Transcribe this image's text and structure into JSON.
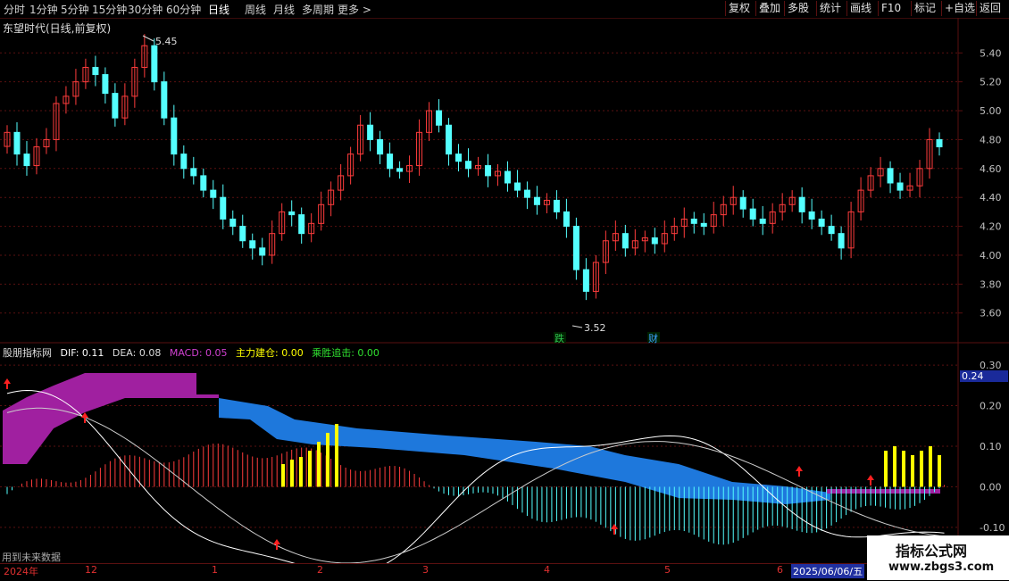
{
  "toolbar": {
    "periods": [
      "分时",
      "1分钟",
      "5分钟",
      "15分钟",
      "30分钟",
      "60分钟",
      "日线",
      "周线",
      "月线",
      "多周期",
      "更多"
    ],
    "active_period": "日线",
    "right_buttons": [
      "复权",
      "叠加",
      "多股",
      "统计",
      "画线",
      "F10",
      "标记",
      "+自选",
      "返回"
    ]
  },
  "main": {
    "title": "东望时代(日线,前复权)",
    "high_marker": "5.45",
    "low_marker": "3.52",
    "badges": [
      {
        "text": "跌",
        "color": "#2ec850"
      },
      {
        "text": "财",
        "color": "#3aa0ff"
      }
    ],
    "y_ticks": [
      "5.40",
      "5.20",
      "5.00",
      "4.80",
      "4.60",
      "4.40",
      "4.20",
      "4.00",
      "3.80",
      "3.60"
    ]
  },
  "indicator": {
    "name": "股朋指标网",
    "dif": "DIF: 0.11",
    "dea": "DEA: 0.08",
    "macd": "MACD: 0.05",
    "zhuli": "主力建仓: 0.00",
    "chengsheng": "乘胜追击: 0.00",
    "y_ticks": [
      "0.30",
      "0.20",
      "0.10",
      "0.00",
      "-0.10"
    ],
    "current_value": "0.24",
    "footer_note": "用到未来数据"
  },
  "datebar": {
    "labels": [
      "2024年",
      "12",
      "1",
      "2",
      "3",
      "4",
      "5",
      "6"
    ],
    "current_date": "2025/06/06/五"
  },
  "watermark": {
    "title": "指标公式网",
    "url": "www.zbgs3.com"
  },
  "colors": {
    "up": "#ff3c3c",
    "down": "#54ffff",
    "purple": "#a020a0",
    "blue": "#1e78dc",
    "yellow": "#ffff00",
    "grid": "#5a1010"
  },
  "chart_data": {
    "type": "candlestick",
    "y_range": [
      3.45,
      5.55
    ],
    "closes": [
      4.85,
      4.7,
      4.62,
      4.75,
      4.8,
      5.05,
      5.1,
      5.2,
      5.3,
      5.25,
      5.12,
      4.95,
      5.1,
      5.3,
      5.45,
      5.2,
      4.95,
      4.7,
      4.6,
      4.55,
      4.45,
      4.4,
      4.25,
      4.2,
      4.1,
      4.05,
      4.0,
      4.15,
      4.3,
      4.28,
      4.15,
      4.22,
      4.35,
      4.45,
      4.55,
      4.7,
      4.9,
      4.8,
      4.7,
      4.6,
      4.58,
      4.62,
      4.85,
      5.0,
      4.9,
      4.7,
      4.65,
      4.6,
      4.62,
      4.55,
      4.58,
      4.5,
      4.45,
      4.4,
      4.35,
      4.38,
      4.3,
      4.2,
      3.9,
      3.75,
      3.95,
      4.1,
      4.15,
      4.05,
      4.1,
      4.12,
      4.08,
      4.15,
      4.2,
      4.25,
      4.22,
      4.2,
      4.28,
      4.35,
      4.4,
      4.32,
      4.25,
      4.22,
      4.3,
      4.35,
      4.4,
      4.3,
      4.25,
      4.2,
      4.15,
      4.05,
      4.3,
      4.45,
      4.55,
      4.6,
      4.5,
      4.45,
      4.48,
      4.6,
      4.8,
      4.75
    ]
  }
}
